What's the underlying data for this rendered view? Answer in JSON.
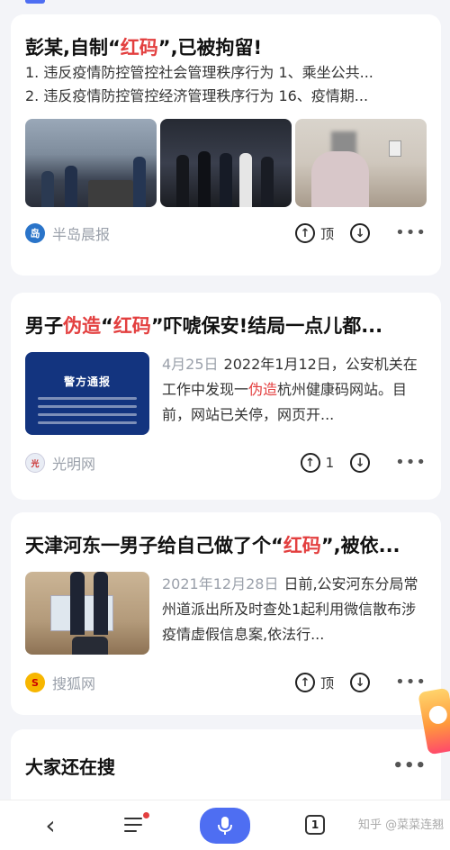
{
  "cards": [
    {
      "title_parts": [
        "彭某,自制“",
        "红码",
        "”,已被拘留!"
      ],
      "lines": [
        "1. 违反疫情防控管控社会管理秩序行为 1、乘坐公共...",
        "2. 违反疫情防控管控经济管理秩序行为 16、疫情期..."
      ],
      "source": "半岛晨报",
      "actions": {
        "up_label": "顶"
      }
    },
    {
      "title_parts": [
        "男子",
        "伪造",
        "“",
        "红码",
        "”吓唬保安!结局一点儿都..."
      ],
      "date": "4月25日",
      "desc_parts": [
        "2022年1月12日，公安机关在工作中发现一",
        "伪造",
        "杭州健康码网站。目前，网站已关停，网页开..."
      ],
      "thumb_title": "警方通报",
      "source": "光明网",
      "actions": {
        "up_count": "1"
      }
    },
    {
      "title_parts": [
        "天津河东一男子给自己做了个“",
        "红码",
        "”,被依..."
      ],
      "date": "2021年12月28日",
      "desc": "日前,公安河东分局常州道派出所及时查处1起利用微信散布涉疫情虚假信息案,依法行...",
      "source": "搜狐网",
      "actions": {
        "up_label": "顶"
      }
    }
  ],
  "search_section": {
    "title": "大家还在搜"
  },
  "bottom_bar": {
    "back_icon": "‹",
    "tabs_count": "1",
    "watermark": "知乎 @菜菜连翘"
  },
  "colors": {
    "accent": "#4e6ef2",
    "highlight": "#e33f3f",
    "source": "#9aa0aa"
  },
  "icons": [
    "thumb-up-icon",
    "thumb-down-icon",
    "more-icon",
    "back-icon",
    "menu-icon",
    "mic-icon",
    "tabs-icon"
  ]
}
